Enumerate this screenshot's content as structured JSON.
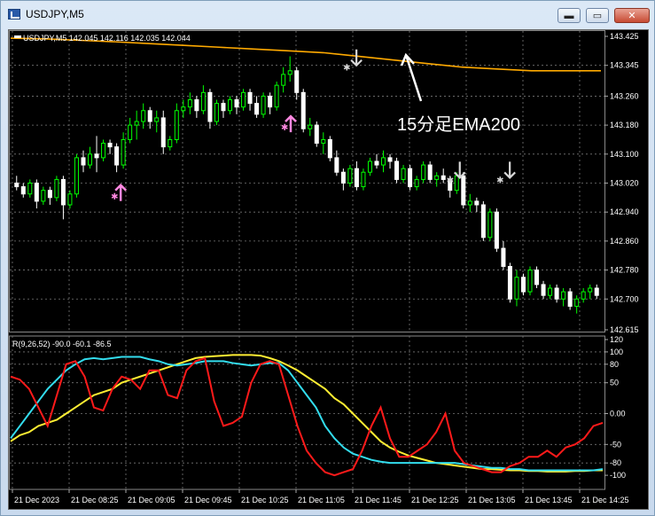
{
  "window": {
    "title": "USDJPY,M5"
  },
  "controls": {
    "minimize": "▬",
    "restore": "▭",
    "close": "✕"
  },
  "main_info": "USDJPY,M5  142.045 142.116 142.035 142.044",
  "annotation": "15分足EMA200",
  "indicator_info": "R(9,26,52) -90.0 -60.1 -86.5",
  "price_labels": [
    "143.425",
    "143.345",
    "143.260",
    "143.180",
    "143.100",
    "143.020",
    "142.940",
    "142.860",
    "142.780",
    "142.700",
    "142.615"
  ],
  "indicator_labels": [
    "120",
    "100",
    "80",
    "50",
    "0.00",
    "-50",
    "-80",
    "-100"
  ],
  "time_labels": [
    "21 Dec 2023",
    "21 Dec 08:25",
    "21 Dec 09:05",
    "21 Dec 09:45",
    "21 Dec 10:25",
    "21 Dec 11:05",
    "21 Dec 11:45",
    "21 Dec 12:25",
    "21 Dec 13:05",
    "21 Dec 13:45",
    "21 Dec 14:25"
  ],
  "colors": {
    "bull": "#00ff00",
    "bear": "#ffffff",
    "ema": "#ffaa00",
    "rci_short": "#ff1a1a",
    "rci_mid": "#33ddee",
    "rci_long": "#ffee33",
    "buy_arrow": "#ff88e0",
    "sell_arrow": "#d8d8d8"
  },
  "chart_data": {
    "type": "candlestick",
    "ylim": [
      142.615,
      143.425
    ],
    "candles": [
      [
        143.02,
        143.04,
        143.0,
        143.01
      ],
      [
        143.01,
        143.02,
        142.98,
        142.99
      ],
      [
        142.99,
        143.03,
        142.98,
        143.02
      ],
      [
        143.02,
        143.03,
        142.95,
        142.97
      ],
      [
        142.97,
        143.01,
        142.96,
        143.0
      ],
      [
        143.0,
        143.01,
        142.96,
        142.98
      ],
      [
        142.98,
        143.04,
        142.97,
        143.03
      ],
      [
        143.03,
        143.04,
        142.92,
        142.96
      ],
      [
        142.96,
        143.0,
        142.95,
        142.99
      ],
      [
        142.99,
        143.1,
        142.98,
        143.09
      ],
      [
        143.09,
        143.11,
        143.05,
        143.07
      ],
      [
        143.07,
        143.12,
        143.06,
        143.1
      ],
      [
        143.1,
        143.15,
        143.05,
        143.09
      ],
      [
        143.09,
        143.14,
        143.08,
        143.13
      ],
      [
        143.13,
        143.14,
        143.1,
        143.12
      ],
      [
        143.12,
        143.13,
        143.05,
        143.07
      ],
      [
        143.07,
        143.16,
        143.06,
        143.14
      ],
      [
        143.14,
        143.2,
        143.13,
        143.18
      ],
      [
        143.18,
        143.22,
        143.14,
        143.19
      ],
      [
        143.19,
        143.24,
        143.17,
        143.22
      ],
      [
        143.22,
        143.23,
        143.17,
        143.19
      ],
      [
        143.19,
        143.22,
        143.16,
        143.2
      ],
      [
        143.2,
        143.22,
        143.1,
        143.12
      ],
      [
        143.12,
        143.15,
        143.11,
        143.14
      ],
      [
        143.14,
        143.24,
        143.13,
        143.22
      ],
      [
        143.22,
        143.25,
        143.2,
        143.23
      ],
      [
        143.23,
        143.27,
        143.21,
        143.25
      ],
      [
        143.25,
        143.26,
        143.2,
        143.22
      ],
      [
        143.22,
        143.29,
        143.21,
        143.27
      ],
      [
        143.27,
        143.28,
        143.17,
        143.19
      ],
      [
        143.19,
        143.25,
        143.18,
        143.24
      ],
      [
        143.24,
        143.25,
        143.2,
        143.22
      ],
      [
        143.22,
        143.26,
        143.21,
        143.25
      ],
      [
        143.25,
        143.26,
        143.21,
        143.23
      ],
      [
        143.23,
        143.28,
        143.22,
        143.27
      ],
      [
        143.27,
        143.28,
        143.22,
        143.24
      ],
      [
        143.24,
        143.26,
        143.2,
        143.21
      ],
      [
        143.21,
        143.27,
        143.2,
        143.26
      ],
      [
        143.26,
        143.27,
        143.21,
        143.23
      ],
      [
        143.23,
        143.3,
        143.22,
        143.29
      ],
      [
        143.29,
        143.34,
        143.27,
        143.32
      ],
      [
        143.32,
        143.37,
        143.3,
        143.33
      ],
      [
        143.33,
        143.34,
        143.25,
        143.27
      ],
      [
        143.27,
        143.28,
        143.16,
        143.17
      ],
      [
        143.17,
        143.2,
        143.15,
        143.18
      ],
      [
        143.18,
        143.19,
        143.12,
        143.13
      ],
      [
        143.13,
        143.16,
        143.1,
        143.14
      ],
      [
        143.14,
        143.15,
        143.08,
        143.09
      ],
      [
        143.09,
        143.11,
        143.04,
        143.05
      ],
      [
        143.05,
        143.06,
        143.0,
        143.02
      ],
      [
        143.02,
        143.07,
        143.01,
        143.06
      ],
      [
        143.06,
        143.08,
        143.0,
        143.01
      ],
      [
        143.01,
        143.06,
        143.0,
        143.05
      ],
      [
        143.05,
        143.09,
        143.04,
        143.08
      ],
      [
        143.08,
        143.1,
        143.06,
        143.07
      ],
      [
        143.07,
        143.11,
        143.05,
        143.09
      ],
      [
        143.09,
        143.1,
        143.06,
        143.08
      ],
      [
        143.08,
        143.09,
        143.02,
        143.03
      ],
      [
        143.03,
        143.07,
        143.02,
        143.06
      ],
      [
        143.06,
        143.07,
        143.0,
        143.01
      ],
      [
        143.01,
        143.04,
        143.0,
        143.03
      ],
      [
        143.03,
        143.08,
        143.02,
        143.07
      ],
      [
        143.07,
        143.08,
        143.02,
        143.03
      ],
      [
        143.03,
        143.05,
        143.01,
        143.04
      ],
      [
        143.04,
        143.06,
        143.02,
        143.03
      ],
      [
        143.03,
        143.04,
        142.98,
        143.0
      ],
      [
        143.0,
        143.05,
        142.99,
        143.04
      ],
      [
        143.04,
        143.05,
        142.95,
        142.96
      ],
      [
        142.96,
        142.99,
        142.94,
        142.97
      ],
      [
        142.97,
        142.98,
        142.94,
        142.96
      ],
      [
        142.96,
        142.97,
        142.86,
        142.87
      ],
      [
        142.87,
        142.95,
        142.86,
        142.94
      ],
      [
        142.94,
        142.95,
        142.83,
        142.84
      ],
      [
        142.84,
        142.86,
        142.78,
        142.79
      ],
      [
        142.79,
        142.8,
        142.69,
        142.7
      ],
      [
        142.7,
        142.78,
        142.68,
        142.76
      ],
      [
        142.76,
        142.77,
        142.71,
        142.72
      ],
      [
        142.72,
        142.79,
        142.71,
        142.78
      ],
      [
        142.78,
        142.79,
        142.73,
        142.74
      ],
      [
        142.74,
        142.75,
        142.7,
        142.71
      ],
      [
        142.71,
        142.74,
        142.7,
        142.73
      ],
      [
        142.73,
        142.74,
        142.69,
        142.7
      ],
      [
        142.7,
        142.73,
        142.68,
        142.72
      ],
      [
        142.72,
        142.73,
        142.67,
        142.68
      ],
      [
        142.68,
        142.71,
        142.66,
        142.7
      ],
      [
        142.7,
        142.73,
        142.69,
        142.72
      ],
      [
        142.72,
        142.74,
        142.7,
        142.73
      ],
      [
        142.73,
        142.74,
        142.7,
        142.71
      ]
    ],
    "ema": [
      143.42,
      143.418,
      143.414,
      143.41,
      143.405,
      143.4,
      143.395,
      143.39,
      143.385,
      143.38,
      143.37,
      143.36,
      143.35,
      143.34,
      143.335,
      143.33,
      143.33,
      143.33
    ],
    "buy_signals": [
      [
        15,
        142.985
      ],
      [
        66,
        143.175
      ]
    ],
    "sell_signals": [
      [
        78,
        143.34
      ],
      [
        109,
        143.03
      ],
      [
        124,
        143.03
      ]
    ],
    "rci": {
      "ylim": [
        -120,
        120
      ],
      "series": [
        {
          "values": [
            60,
            55,
            40,
            10,
            -20,
            30,
            80,
            85,
            60,
            10,
            5,
            40,
            60,
            55,
            40,
            70,
            70,
            30,
            25,
            70,
            85,
            90,
            20,
            -20,
            -15,
            -5,
            50,
            80,
            85,
            80,
            30,
            -20,
            -60,
            -80,
            -95,
            -100,
            -95,
            -90,
            -60,
            -20,
            10,
            -40,
            -70,
            -70,
            -60,
            -50,
            -30,
            0,
            -60,
            -80,
            -85,
            -90,
            -95,
            -95,
            -85,
            -80,
            -70,
            -70,
            -60,
            -70,
            -55,
            -50,
            -40,
            -20,
            -15
          ]
        },
        {
          "values": [
            -40,
            -20,
            0,
            20,
            40,
            55,
            70,
            80,
            88,
            90,
            88,
            90,
            92,
            92,
            92,
            88,
            85,
            80,
            78,
            80,
            82,
            85,
            85,
            85,
            82,
            80,
            78,
            80,
            82,
            82,
            70,
            50,
            30,
            10,
            -20,
            -40,
            -55,
            -65,
            -70,
            -75,
            -78,
            -80,
            -80,
            -80,
            -80,
            -80,
            -80,
            -80,
            -80,
            -82,
            -84,
            -86,
            -88,
            -88,
            -90,
            -90,
            -92,
            -92,
            -92,
            -92,
            -92,
            -92,
            -92,
            -92,
            -90
          ]
        },
        {
          "values": [
            -45,
            -35,
            -30,
            -20,
            -15,
            -10,
            0,
            10,
            20,
            30,
            35,
            40,
            50,
            55,
            60,
            65,
            70,
            75,
            80,
            85,
            90,
            92,
            93,
            94,
            95,
            95,
            95,
            94,
            90,
            85,
            78,
            70,
            60,
            50,
            40,
            25,
            15,
            0,
            -15,
            -30,
            -45,
            -55,
            -62,
            -68,
            -72,
            -76,
            -80,
            -82,
            -84,
            -86,
            -88,
            -90,
            -90,
            -91,
            -92,
            -92,
            -93,
            -93,
            -94,
            -94,
            -94,
            -93,
            -93,
            -92,
            -92
          ]
        }
      ]
    }
  }
}
